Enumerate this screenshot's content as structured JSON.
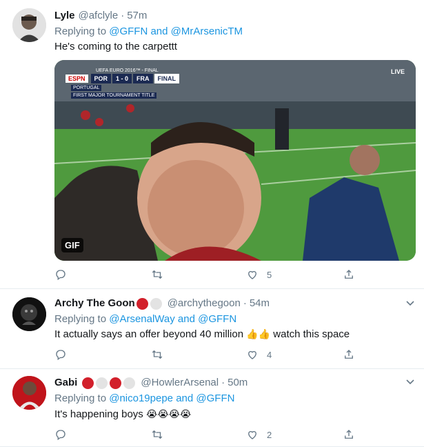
{
  "tweets": [
    {
      "name": "Lyle",
      "handle": "@afclyle",
      "time": "57m",
      "reply_prefix": "Replying to",
      "reply_user1": "@GFFN",
      "reply_and": "and",
      "reply_user2": "@MrArsenicTM",
      "text": "He's coming to the carpettt",
      "media": {
        "badge": "GIF",
        "live": "LIVE",
        "score_top": "UEFA EURO 2016™ - FINAL",
        "score_espn": "ESPN",
        "score_home": "POR",
        "score": "1 - 0",
        "score_away": "FRA",
        "score_status": "FINAL",
        "score_sub1": "PORTUGAL",
        "score_sub2": "FIRST MAJOR TOURNAMENT TITLE"
      },
      "likes": "5"
    },
    {
      "name": "Archy The Goon",
      "handle": "@archythegoon",
      "time": "54m",
      "reply_prefix": "Replying to",
      "reply_user1": "@ArsenalWay",
      "reply_and": "and",
      "reply_user2": "@GFFN",
      "text_before": "It actually says an offer beyond 40 million",
      "emoji": "👍👍",
      "text_after": "watch this space",
      "likes": "4"
    },
    {
      "name": "Gabi",
      "handle": "@HowlerArsenal",
      "time": "50m",
      "reply_prefix": "Replying to",
      "reply_user1": "@nico19pepe",
      "reply_and": "and",
      "reply_user2": "@GFFN",
      "text_before": "It's happening boys",
      "emoji": "😭😭😭😭",
      "likes": "2"
    }
  ],
  "colors": {
    "link": "#1b95e0",
    "muted": "#657786",
    "text": "#14171a",
    "border": "#e6ecf0",
    "red_dot": "#d2202b",
    "grey_dot": "#e3e3e3"
  },
  "icons": [
    "reply-icon",
    "retweet-icon",
    "like-icon",
    "share-icon",
    "caret-down-icon"
  ]
}
